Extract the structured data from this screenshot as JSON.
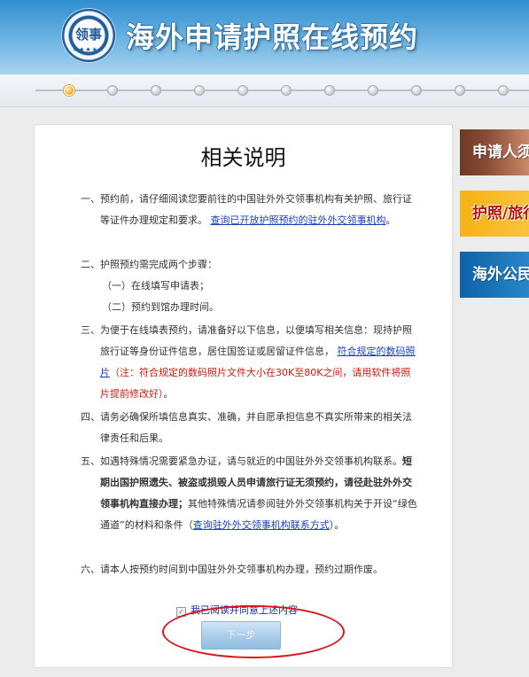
{
  "header": {
    "title": "海外申请护照在线预约",
    "emblem_icon": "consular-affairs-emblem-icon",
    "emblem_glyph": "领事",
    "emblem_stars": "★★★★★"
  },
  "progress": {
    "current_step": 1,
    "total_steps": 11
  },
  "notice": {
    "title": "相关说明",
    "items": [
      {
        "num": "一、",
        "text": "预约前，请仔细阅读您要前往的中国驻外外交领事机构有关护照、旅行证等证件办理规定和要求。",
        "link": "查询已开放护照预约的驻外外交领事机构",
        "end": "。"
      },
      {
        "num": "二、",
        "text": "护照预约需完成两个步骤：",
        "steps": [
          "（一）在线填写申请表；",
          "（二）预约到馆办理时间。"
        ]
      },
      {
        "num": "三、",
        "text": "为便于在线填表预约，请准备好以下信息，以便填写相关信息：现持护照旅行证等身份证件信息，居住国签证或居留证件信息，",
        "link": "符合规定的数码照片",
        "red": "（注：符合规定的数码照片文件大小在30K至80K之间，请用软件将照片提前修改好）",
        "end": "。"
      },
      {
        "num": "四、",
        "text": "请务必确保所填信息真实、准确，并自愿承担信息不真实所带来的相关法律责任和后果。"
      },
      {
        "num": "五、",
        "text": "如遇特殊情况需要紧急办证，请与就近的中国驻外外交领事机构联系。",
        "bold": "短期出国护照遗失、被盗或损毁人员申请旅行证无须预约，请径赴驻外外交领事机构直接办理；",
        "text2": "其他特殊情况请参阅驻外外交领事机构关于开设“绿色通道”的材料和条件（",
        "link": "查询驻外外交领事机构联系方式",
        "end": "）。"
      },
      {
        "num": "六、",
        "text": "请本人按预约时间到中国驻外外交领事机构办理，预约过期作废。"
      }
    ],
    "agree_label": "我已阅读并同意上述内容",
    "agree_checked": true,
    "next_button": "下一步"
  },
  "side_banners": [
    {
      "label": "申请人须知",
      "color": "#7a4330"
    },
    {
      "label": "护照/旅行证",
      "color": "#f7b214"
    },
    {
      "label": "海外公民",
      "color": "#0d63a8"
    }
  ],
  "colors": {
    "link": "#1a3fbf",
    "warning_text": "#d4170b",
    "highlight_ring": "#d5161b",
    "active_step": "#ffb23a"
  }
}
